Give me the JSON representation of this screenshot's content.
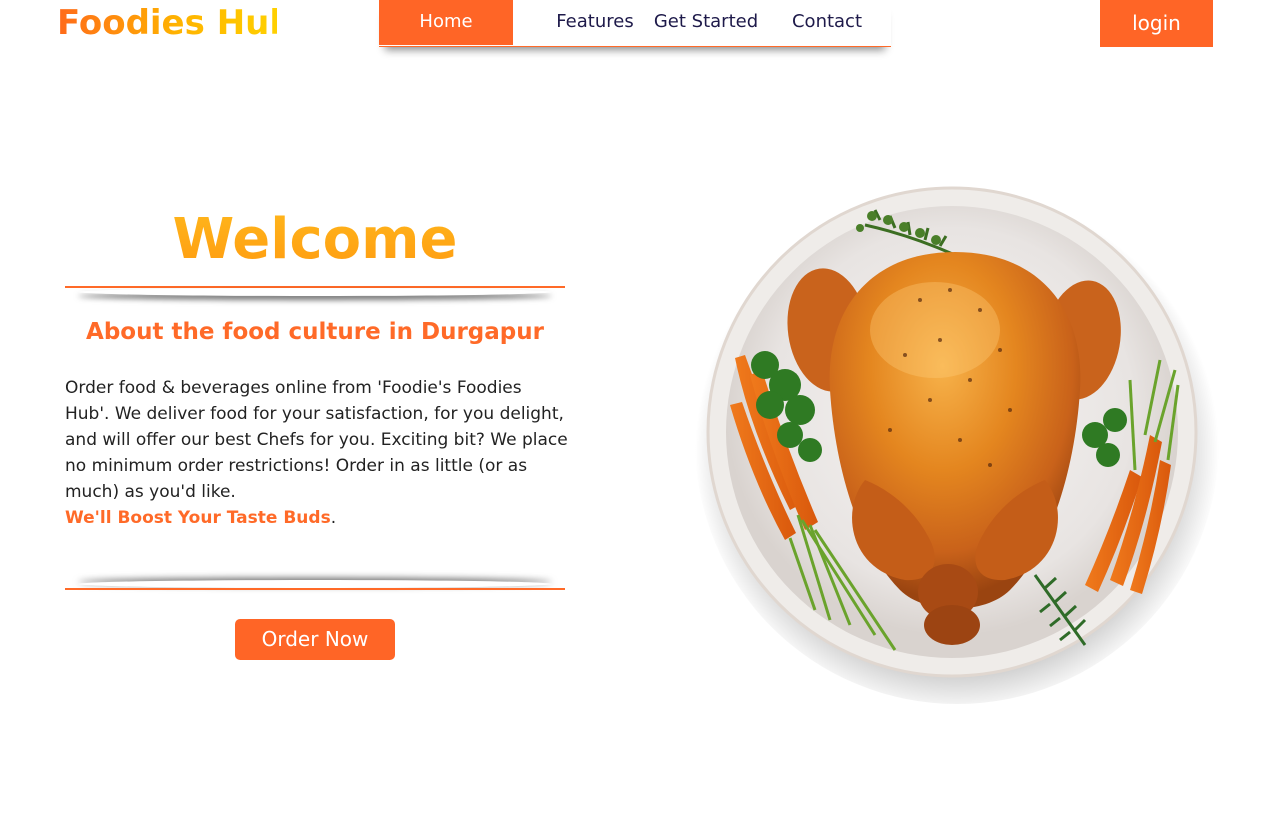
{
  "header": {
    "logo": "Foodies Hub",
    "nav": [
      "Home",
      "Features",
      "Get Started",
      "Contact"
    ],
    "active_nav": "Home",
    "login_label": "login"
  },
  "hero": {
    "title": "Welcome",
    "subtitle": "About the food culture in Durgapur",
    "description": "Order food & beverages online from 'Foodie's Foodies Hub'. We deliver food for your satisfaction, for you delight, and will offer our best Chefs for you. Exciting bit? We place no minimum order restrictions! Order in as little (or as much) as you'd like.",
    "tagline": "We'll Boost Your Taste Buds",
    "tagline_end": ".",
    "cta_label": "Order Now"
  },
  "colors": {
    "accent": "#ff6526",
    "title_gradient_start": "#ffb81c",
    "title_gradient_end": "#ff9a10",
    "nav_text": "#1e1a4a"
  }
}
